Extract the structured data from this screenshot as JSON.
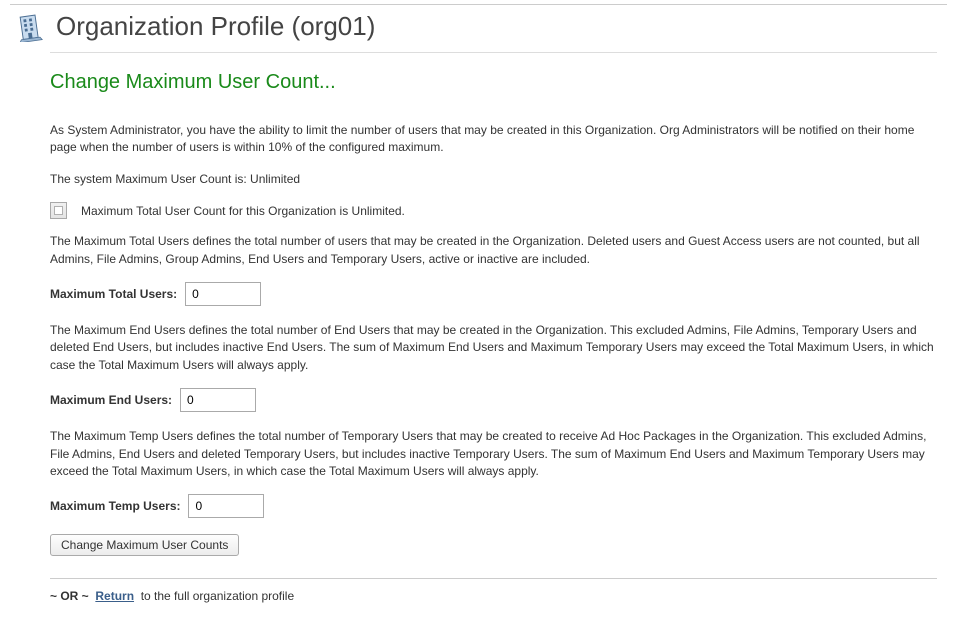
{
  "header": {
    "title": "Organization Profile (org01)"
  },
  "section": {
    "heading": "Change Maximum User Count...",
    "intro": "As System Administrator, you have the ability to limit the number of users that may be created in this Organization. Org Administrators will be notified on their home page when the number of users is within 10% of the configured maximum.",
    "system_line": "The system Maximum User Count is: Unlimited",
    "unlimited_checkbox_label": "Maximum Total User Count for this Organization is Unlimited.",
    "total_desc": "The Maximum Total Users defines the total number of users that may be created in the Organization. Deleted users and Guest Access users are not counted, but all Admins, File Admins, Group Admins, End Users and Temporary Users, active or inactive are included.",
    "total_label": "Maximum Total Users:",
    "total_value": "0",
    "end_desc": "The Maximum End Users defines the total number of End Users that may be created in the Organization. This excluded Admins, File Admins, Temporary Users and deleted End Users, but includes inactive End Users. The sum of Maximum End Users and Maximum Temporary Users may exceed the Total Maximum Users, in which case the Total Maximum Users will always apply.",
    "end_label": "Maximum End Users:",
    "end_value": "0",
    "temp_desc": "The Maximum Temp Users defines the total number of Temporary Users that may be created to receive Ad Hoc Packages in the Organization. This excluded Admins, File Admins, End Users and deleted Temporary Users, but includes inactive Temporary Users. The sum of Maximum End Users and Maximum Temporary Users may exceed the Total Maximum Users, in which case the Total Maximum Users will always apply.",
    "temp_label": "Maximum Temp Users:",
    "temp_value": "0",
    "action_button": "Change Maximum User Counts"
  },
  "footer": {
    "sep": "~ OR ~",
    "return_label": "Return",
    "return_suffix": "to the full organization profile"
  }
}
